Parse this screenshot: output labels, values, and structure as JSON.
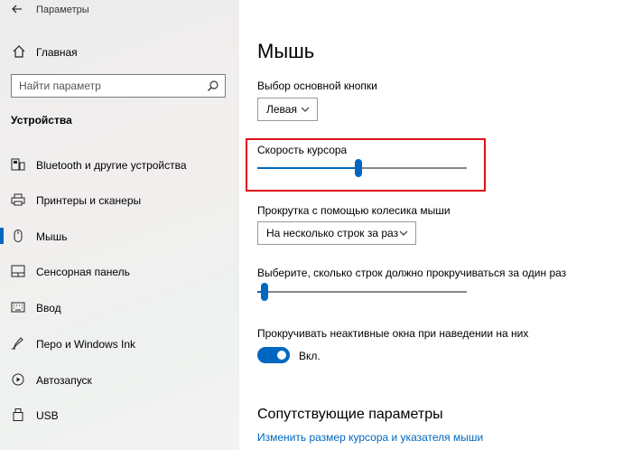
{
  "window": {
    "title": "Параметры"
  },
  "sidebar": {
    "home_label": "Главная",
    "search_placeholder": "Найти параметр",
    "section_title": "Устройства",
    "items": [
      {
        "label": "Bluetooth и другие устройства",
        "icon": "bluetooth-devices-icon"
      },
      {
        "label": "Принтеры и сканеры",
        "icon": "printer-icon"
      },
      {
        "label": "Мышь",
        "icon": "mouse-icon",
        "active": true
      },
      {
        "label": "Сенсорная панель",
        "icon": "touchpad-icon"
      },
      {
        "label": "Ввод",
        "icon": "keyboard-icon"
      },
      {
        "label": "Перо и Windows Ink",
        "icon": "pen-icon"
      },
      {
        "label": "Автозапуск",
        "icon": "autoplay-icon"
      },
      {
        "label": "USB",
        "icon": "usb-icon"
      }
    ]
  },
  "main": {
    "title": "Мышь",
    "primary_button": {
      "label": "Выбор основной кнопки",
      "value": "Левая"
    },
    "cursor_speed": {
      "label": "Скорость курсора",
      "level": 0.48
    },
    "wheel_scroll": {
      "label": "Прокрутка с помощью колесика мыши",
      "value": "На несколько строк за раз"
    },
    "lines_to_scroll": {
      "label": "Выберите, сколько строк должно прокручиваться за один раз",
      "level": 0.02
    },
    "inactive_scroll": {
      "label": "Прокручивать неактивные окна при наведении на них",
      "state": "Вкл."
    },
    "related": {
      "title": "Сопутствующие параметры",
      "link": "Изменить размер курсора и указателя мыши"
    }
  },
  "colors": {
    "accent": "#0067c0",
    "highlight_box": "#e00d16"
  }
}
